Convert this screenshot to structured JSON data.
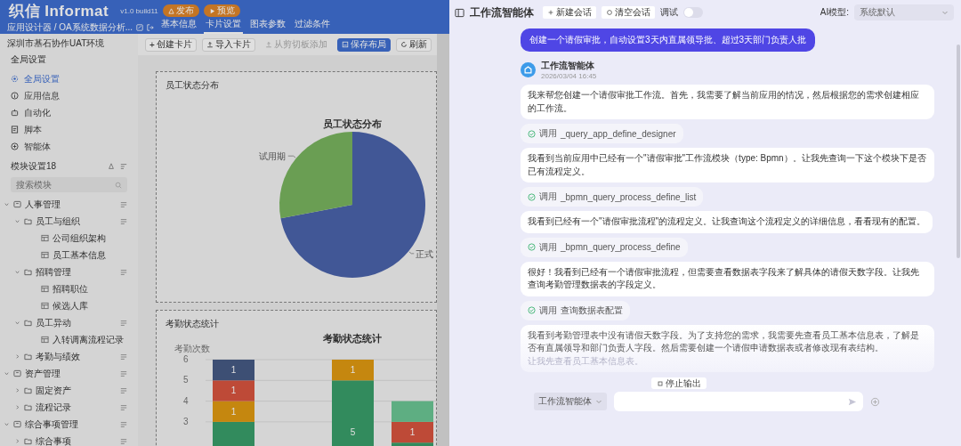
{
  "app": {
    "logo": "织信 Informat",
    "version": "v1.0 build11",
    "header_buttons": [
      {
        "label": "发布",
        "kind": "publish"
      },
      {
        "label": "预览",
        "kind": "preview"
      }
    ],
    "breadcrumb": "应用设计器 / OA系统数据分析...",
    "tabs": [
      {
        "label": "基本信息",
        "selected": false
      },
      {
        "label": "卡片设置",
        "selected": true
      },
      {
        "label": "图表参数",
        "selected": false
      },
      {
        "label": "过滤条件",
        "selected": false
      }
    ],
    "toolbar": [
      {
        "label": "创建卡片",
        "icon": "+",
        "kind": "plain",
        "disabled": false
      },
      {
        "label": "导入卡片",
        "kind": "upload",
        "disabled": false
      },
      {
        "label": "从剪切板添加",
        "kind": "upload",
        "disabled": true
      },
      {
        "label": "保存布局",
        "kind": "save",
        "disabled": false
      },
      {
        "label": "刷新",
        "kind": "refresh",
        "disabled": false
      }
    ]
  },
  "sidebar": {
    "environment": "深圳市基石协作UAT环境",
    "global_title": "全局设置",
    "global_items": [
      {
        "label": "全局设置",
        "selected": true
      },
      {
        "label": "应用信息",
        "selected": false
      },
      {
        "label": "自动化",
        "selected": false
      },
      {
        "label": "脚本",
        "selected": false
      },
      {
        "label": "智能体",
        "selected": false
      }
    ],
    "module_title": "模块设置18",
    "search": {
      "placeholder": "搜索模块"
    },
    "tree": [
      {
        "label": "人事管理",
        "expanded": true,
        "children": [
          {
            "label": "员工与组织",
            "expanded": true,
            "children": [
              {
                "label": "公司组织架构"
              },
              {
                "label": "员工基本信息"
              }
            ]
          },
          {
            "label": "招聘管理",
            "expanded": true,
            "children": [
              {
                "label": "招聘职位"
              },
              {
                "label": "候选人库"
              }
            ]
          },
          {
            "label": "员工异动",
            "expanded": true,
            "children": [
              {
                "label": "入转调离流程记录"
              }
            ]
          },
          {
            "label": "考勤与绩效",
            "expanded": false
          }
        ]
      },
      {
        "label": "资产管理",
        "expanded": true,
        "children": [
          {
            "label": "固定资产",
            "expanded": false
          },
          {
            "label": "流程记录",
            "expanded": false
          }
        ]
      },
      {
        "label": "综合事项管理",
        "expanded": true,
        "children": [
          {
            "label": "综合事项",
            "expanded": false
          }
        ]
      }
    ]
  },
  "cards": [
    {
      "title": "员工状态分布",
      "chart_data": {
        "type": "pie",
        "title": "员工状态分布",
        "categories": [
          "正式",
          "试用期"
        ],
        "values": [
          72,
          28
        ]
      }
    },
    {
      "title": "考勤状态统计",
      "chart_data": {
        "type": "bar",
        "title": "考勤状态统计",
        "ylabel": "考勤次数",
        "stacked": true,
        "grid": true,
        "ylim": [
          0,
          6
        ],
        "yticks": [
          3,
          4,
          5,
          6
        ],
        "series": [
          {
            "color": "#3a9f6a",
            "values": [
              3,
              null,
              5,
              2
            ],
            "value_labels": [
              null,
              null,
              "5",
              null
            ]
          },
          {
            "color": "#e19a12",
            "values": [
              1,
              null,
              1,
              null
            ],
            "value_labels": [
              "1",
              null,
              "1",
              null
            ]
          },
          {
            "color": "#d9553f",
            "values": [
              1,
              null,
              null,
              1
            ],
            "value_labels": [
              "1",
              null,
              null,
              "1"
            ]
          },
          {
            "color": "#465a84",
            "values": [
              1,
              null,
              null,
              null
            ],
            "value_labels": [
              "1",
              null,
              null,
              null
            ]
          },
          {
            "color": "#6cc794",
            "values": [
              null,
              null,
              null,
              1
            ],
            "value_labels": [
              null,
              null,
              null,
              null
            ]
          }
        ]
      }
    }
  ],
  "agent_panel": {
    "title": "工作流智能体",
    "new_chat": "新建会话",
    "clear_chat": "清空会话",
    "debug": {
      "label": "调试",
      "on": false
    },
    "model_label": "AI模型:",
    "model_value": "系统默认",
    "user_message": "创建一个请假审批，自动设置3天内直属领导批、超过3天部门负责人批",
    "agent_name": "工作流智能体",
    "timestamp": "2026/03/04 16:45",
    "messages": [
      {
        "kind": "text",
        "text": "我来帮您创建一个请假审批工作流。首先，我需要了解当前应用的情况，然后根据您的需求创建相应的工作流。"
      },
      {
        "kind": "tool",
        "label": "调用",
        "name": "_query_app_define_designer"
      },
      {
        "kind": "text",
        "text": "我看到当前应用中已经有一个\"请假审批\"工作流模块（type: Bpmn）。让我先查询一下这个模块下是否已有流程定义。"
      },
      {
        "kind": "tool",
        "label": "调用",
        "name": "_bpmn_query_process_define_list"
      },
      {
        "kind": "text",
        "text": "我看到已经有一个\"请假审批流程\"的流程定义。让我查询这个流程定义的详细信息，看看现有的配置。"
      },
      {
        "kind": "tool",
        "label": "调用",
        "name": "_bpmn_query_process_define"
      },
      {
        "kind": "text",
        "text": "很好！我看到已经有一个请假审批流程，但需要查看数据表字段来了解具体的请假天数字段。让我先查询考勤管理数据表的字段定义。"
      },
      {
        "kind": "tool",
        "label": "调用",
        "name": "查询数据表配置"
      },
      {
        "kind": "stream",
        "text": "我看到考勤管理表中没有请假天数字段。为了支持您的需求，我需要先查看员工基本信息表，了解是否有直属领导和部门负责人字段。然后需要创建一个请假申请数据表或者修改现有表结构。",
        "tail": "让我先查看员工基本信息表。"
      }
    ],
    "stop_button": "停止输出",
    "agent_select": "工作流智能体"
  }
}
